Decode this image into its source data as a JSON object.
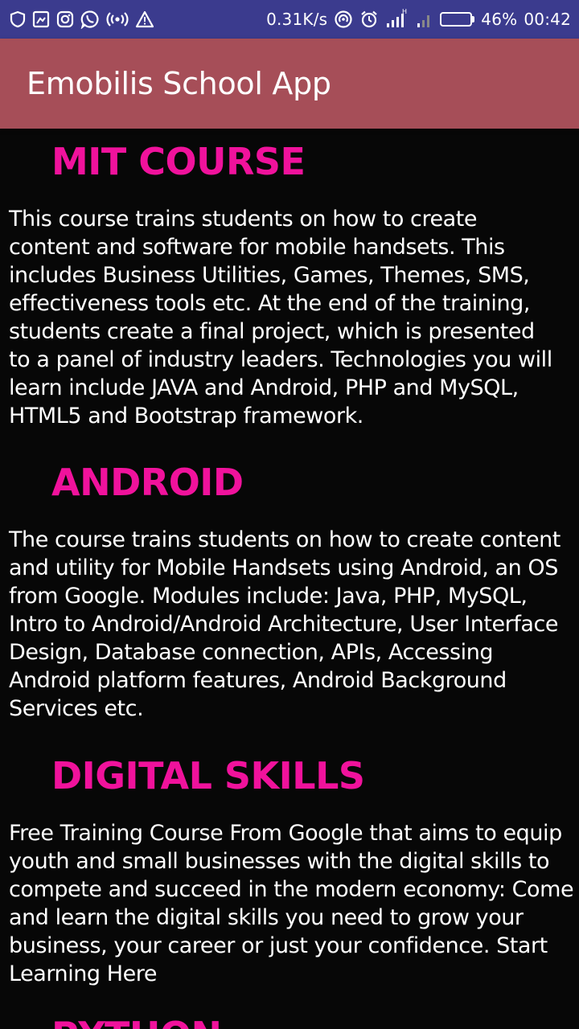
{
  "status_bar": {
    "net_speed": "0.31K/s",
    "battery_percent": "46%",
    "battery_level": 0.46,
    "time": "00:42",
    "left_icons": [
      "shield-icon",
      "screenshot-icon",
      "instagram-icon",
      "whatsapp-icon",
      "hotspot-icon",
      "warning-icon"
    ],
    "right_icons": [
      "wifi-hotspot-icon",
      "alarm-icon",
      "signal-h-icon",
      "signal-icon"
    ]
  },
  "app_bar": {
    "title": "Emobilis School App",
    "color": "#a64e58"
  },
  "colors": {
    "status_bar": "#3b3b8e",
    "background": "#070707",
    "heading": "#f0129c",
    "body_text": "#ffffff"
  },
  "sections": [
    {
      "title": "MIT COURSE",
      "body": "This course trains students on how to create\ncontent and software for mobile handsets. This\nincludes Business Utilities, Games, Themes, SMS,\neffectiveness tools etc. At the end of the training,\nstudents create a final project, which is presented\nto a panel of industry leaders. Technologies you will\nlearn include JAVA and Android, PHP and MySQL,\nHTML5  and Bootstrap framework."
    },
    {
      "title": "ANDROID",
      "body": "The course trains students on how to create content\nand utility for Mobile Handsets using Android, an OS\nfrom Google. Modules include: Java, PHP, MySQL,\nIntro to Android/Android Architecture, User Interface\nDesign, Database connection, APIs, Accessing\nAndroid platform features, Android Background\nServices etc."
    },
    {
      "title": "DIGITAL SKILLS",
      "body": "Free Training Course From Google that aims to equip\nyouth and small businesses with the digital skills to\ncompete and succeed in the modern economy: Come\nand learn the digital skills you need to grow your\nbusiness, your career or just your confidence. Start\nLearning Here"
    },
    {
      "title": "PYTHON"
    }
  ]
}
